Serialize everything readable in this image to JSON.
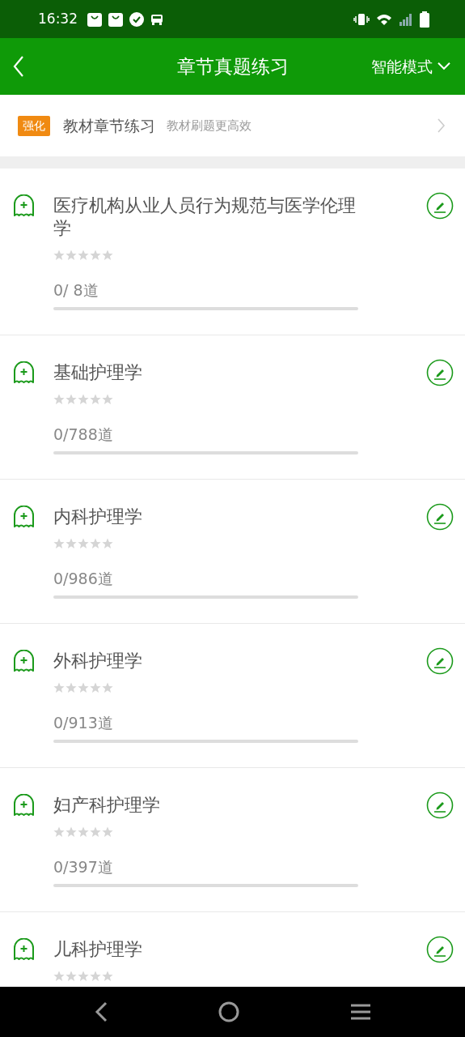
{
  "status_bar": {
    "time": "16:32"
  },
  "app_bar": {
    "title": "章节真题练习",
    "mode": "智能模式"
  },
  "banner": {
    "badge": "强化",
    "title": "教材章节练习",
    "subtitle": "教材刷题更高效"
  },
  "chapters": [
    {
      "title": "医疗机构从业人员行为规范与医学伦理学",
      "stars": 0,
      "count": "0/ 8道",
      "level": 0
    },
    {
      "title": "基础护理学",
      "stars": 0,
      "count": "0/788道",
      "level": 0
    },
    {
      "title": "内科护理学",
      "stars": 0,
      "count": "0/986道",
      "level": 0
    },
    {
      "title": "外科护理学",
      "stars": 0,
      "count": "0/913道",
      "level": 0
    },
    {
      "title": "妇产科护理学",
      "stars": 0,
      "count": "0/397道",
      "level": 0
    },
    {
      "title": "儿科护理学",
      "stars": 0
    }
  ]
}
